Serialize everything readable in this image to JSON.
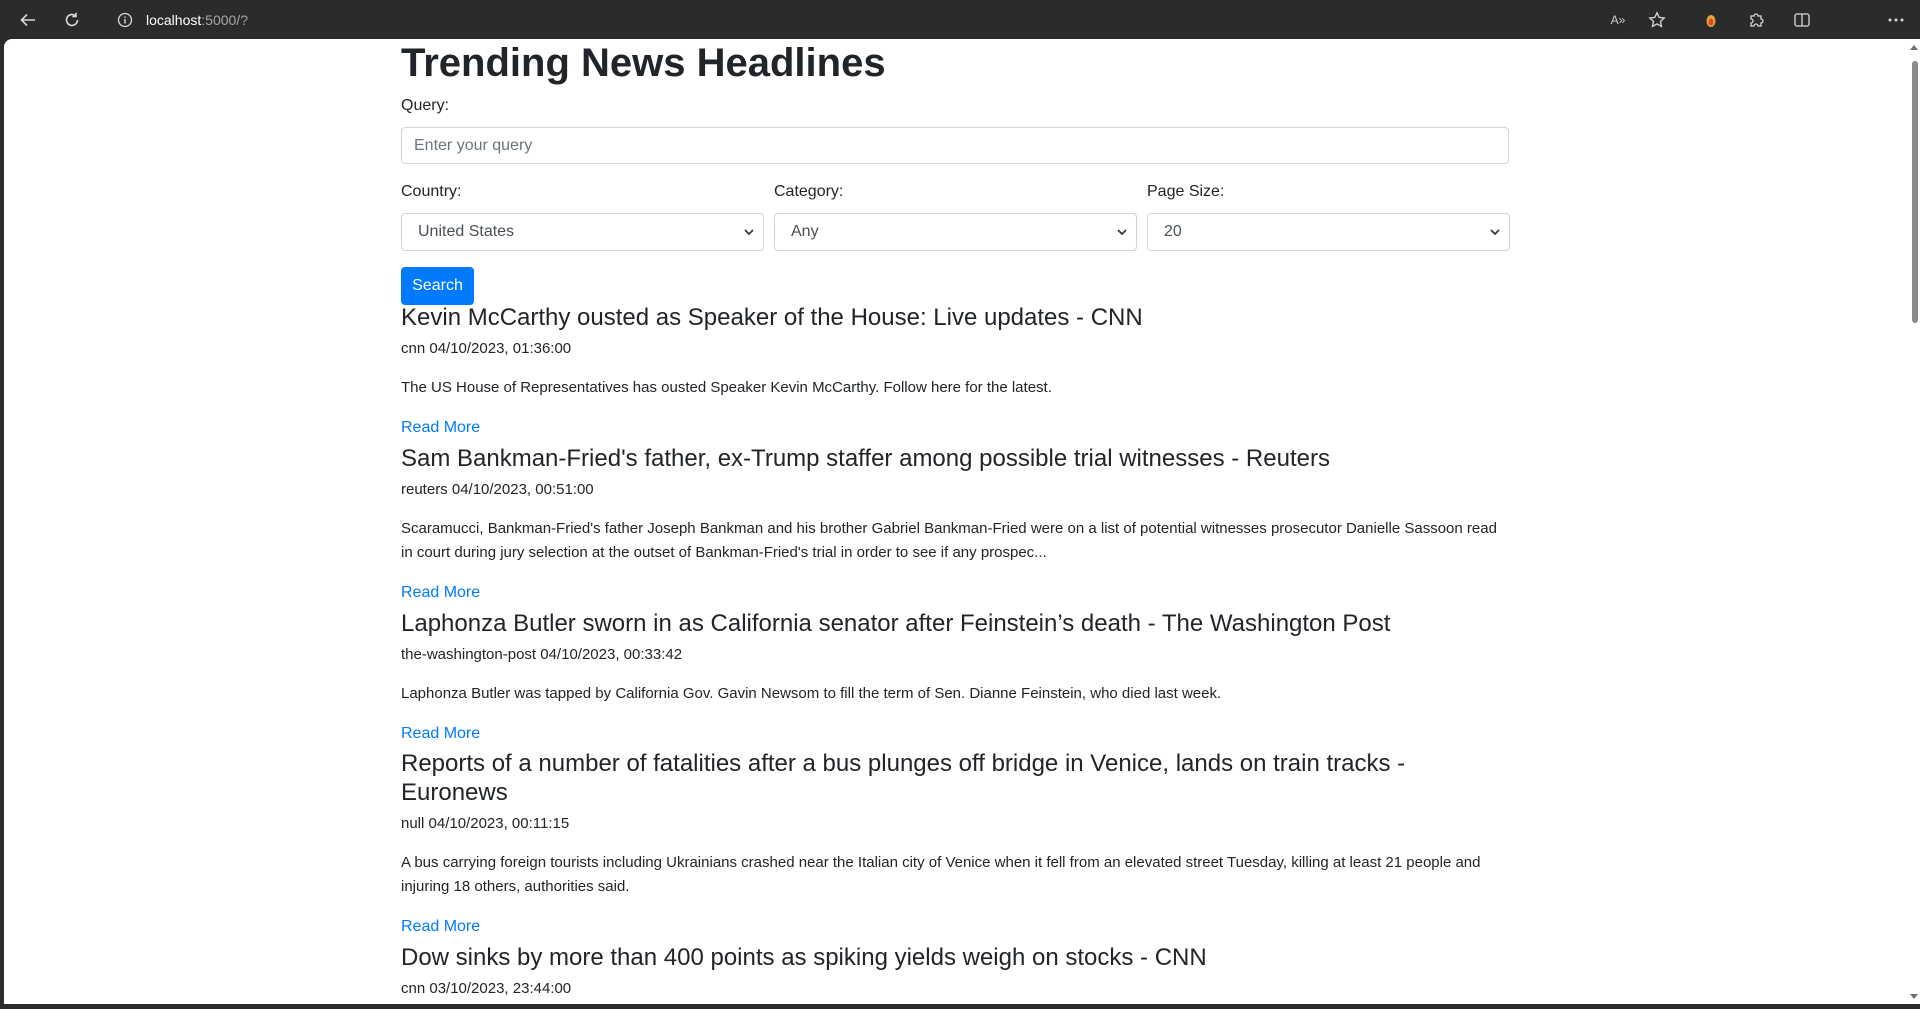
{
  "browser": {
    "url_host": "localhost",
    "url_path": ":5000/?",
    "read_aloud_icon": "A»"
  },
  "page": {
    "title": "Trending News Headlines",
    "query_label": "Query:",
    "query_placeholder": "Enter your query",
    "query_value": "",
    "country_label": "Country:",
    "country_value": "United States",
    "category_label": "Category:",
    "category_value": "Any",
    "page_size_label": "Page Size:",
    "page_size_value": "20",
    "search_button": "Search"
  },
  "articles": [
    {
      "title": "Kevin McCarthy ousted as Speaker of the House: Live updates - CNN",
      "meta": "cnn 04/10/2023, 01:36:00",
      "description": "The US House of Representatives has ousted Speaker Kevin McCarthy. Follow here for the latest.",
      "link": "Read More"
    },
    {
      "title": "Sam Bankman-Fried's father, ex-Trump staffer among possible trial witnesses - Reuters",
      "meta": "reuters 04/10/2023, 00:51:00",
      "description": "Scaramucci, Bankman-Fried's father Joseph Bankman and his brother Gabriel Bankman-Fried were on a list of potential witnesses prosecutor Danielle Sassoon read in court during jury selection at the outset of Bankman-Fried's trial in order to see if any prospec...",
      "link": "Read More"
    },
    {
      "title": "Laphonza Butler sworn in as California senator after Feinstein’s death - The Washington Post",
      "meta": "the-washington-post 04/10/2023, 00:33:42",
      "description": "Laphonza Butler was tapped by California Gov. Gavin Newsom to fill the term of Sen. Dianne Feinstein, who died last week.",
      "link": "Read More"
    },
    {
      "title": "Reports of a number of fatalities after a bus plunges off bridge in Venice, lands on train tracks - Euronews",
      "meta": "null 04/10/2023, 00:11:15",
      "description": "A bus carrying foreign tourists including Ukrainians crashed near the Italian city of Venice when it fell from an elevated street Tuesday, killing at least 21 people and injuring 18 others, authorities said.",
      "link": "Read More"
    },
    {
      "title": "Dow sinks by more than 400 points as spiking yields weigh on stocks - CNN",
      "meta": "cnn 03/10/2023, 23:44:00",
      "description": "",
      "link": ""
    }
  ]
}
